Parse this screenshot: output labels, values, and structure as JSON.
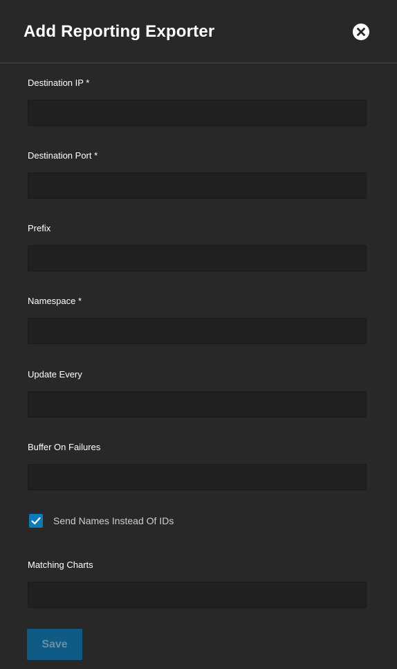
{
  "dialog": {
    "title": "Add Reporting Exporter"
  },
  "fields": [
    {
      "label": "Destination IP *",
      "value": "",
      "placeholder": ""
    },
    {
      "label": "Destination Port *",
      "value": "",
      "placeholder": ""
    },
    {
      "label": "Prefix",
      "value": "",
      "placeholder": ""
    },
    {
      "label": "Namespace *",
      "value": "",
      "placeholder": ""
    },
    {
      "label": "Update Every",
      "value": "",
      "placeholder": ""
    },
    {
      "label": "Buffer On Failures",
      "value": "",
      "placeholder": ""
    }
  ],
  "send_names": {
    "label": "Send Names Instead Of IDs",
    "checked": true
  },
  "matching_charts": {
    "label": "Matching Charts",
    "value": "",
    "placeholder": ""
  },
  "actions": {
    "save_label": "Save"
  },
  "icons": {
    "close": "close-circle-icon",
    "check": "checkmark-icon"
  },
  "colors": {
    "background": "#282828",
    "input_background": "#202020",
    "accent": "#0f7ab8",
    "save_button": "#0e5c86"
  }
}
